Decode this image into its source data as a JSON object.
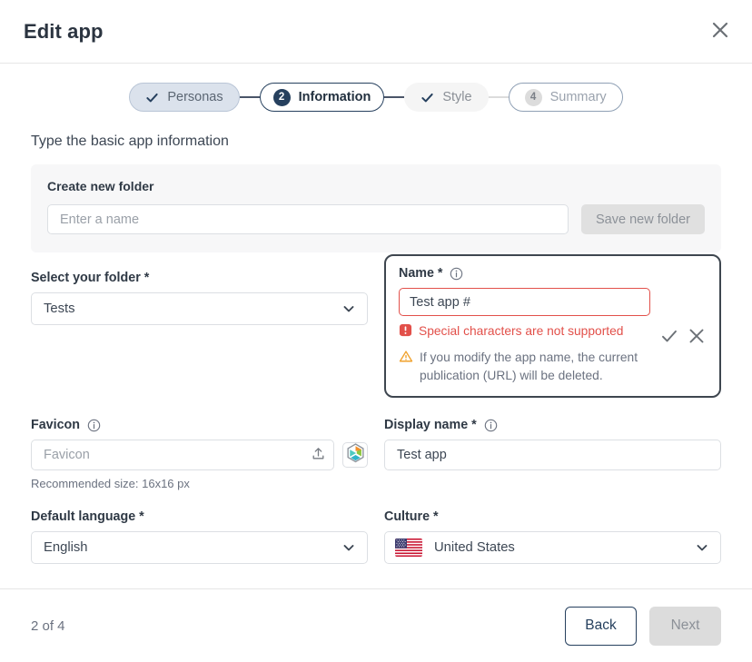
{
  "header": {
    "title": "Edit app",
    "close_icon": "close-icon"
  },
  "stepper": {
    "steps": [
      {
        "label": "Personas",
        "marker": "check",
        "state": "done"
      },
      {
        "label": "Information",
        "marker": "2",
        "state": "current"
      },
      {
        "label": "Style",
        "marker": "check",
        "state": "muted-done"
      },
      {
        "label": "Summary",
        "marker": "4",
        "state": "pending"
      }
    ]
  },
  "main": {
    "section_title": "Type the basic app information",
    "folder_panel": {
      "label": "Create new folder",
      "input_value": "",
      "input_placeholder": "Enter a name",
      "save_button": "Save new folder"
    },
    "select_folder": {
      "label": "Select your folder *",
      "value": "Tests",
      "chevron_icon": "chevron-down-icon"
    },
    "name_field": {
      "label": "Name *",
      "info_icon": "info-icon",
      "value": "Test app #",
      "error_icon": "error-icon",
      "error_text": "Special characters are not supported",
      "warning_icon": "warning-triangle-icon",
      "warning_text": "If you modify the app name, the current publication (URL) will be deleted.",
      "confirm_icon": "check-icon",
      "cancel_icon": "close-icon"
    },
    "favicon": {
      "label": "Favicon",
      "info_icon": "info-icon",
      "value": "",
      "placeholder": "Favicon",
      "upload_icon": "upload-icon",
      "thumb_icon": "hexagon-logo-icon",
      "hint": "Recommended size: 16x16 px"
    },
    "display_name": {
      "label": "Display name *",
      "info_icon": "info-icon",
      "value": "Test app"
    },
    "default_language": {
      "label": "Default language *",
      "value": "English",
      "chevron_icon": "chevron-down-icon"
    },
    "culture": {
      "label": "Culture *",
      "flag_icon": "us-flag-icon",
      "value": "United States",
      "chevron_icon": "chevron-down-icon"
    }
  },
  "footer": {
    "page_count": "2 of 4",
    "back_label": "Back",
    "next_label": "Next"
  },
  "colors": {
    "accent_dark_blue": "#26405e",
    "error_red": "#e2504a",
    "warning_orange": "#f0a22e",
    "step_done_bg": "#dbe2ec",
    "disabled_gray": "#dcdcdc"
  }
}
